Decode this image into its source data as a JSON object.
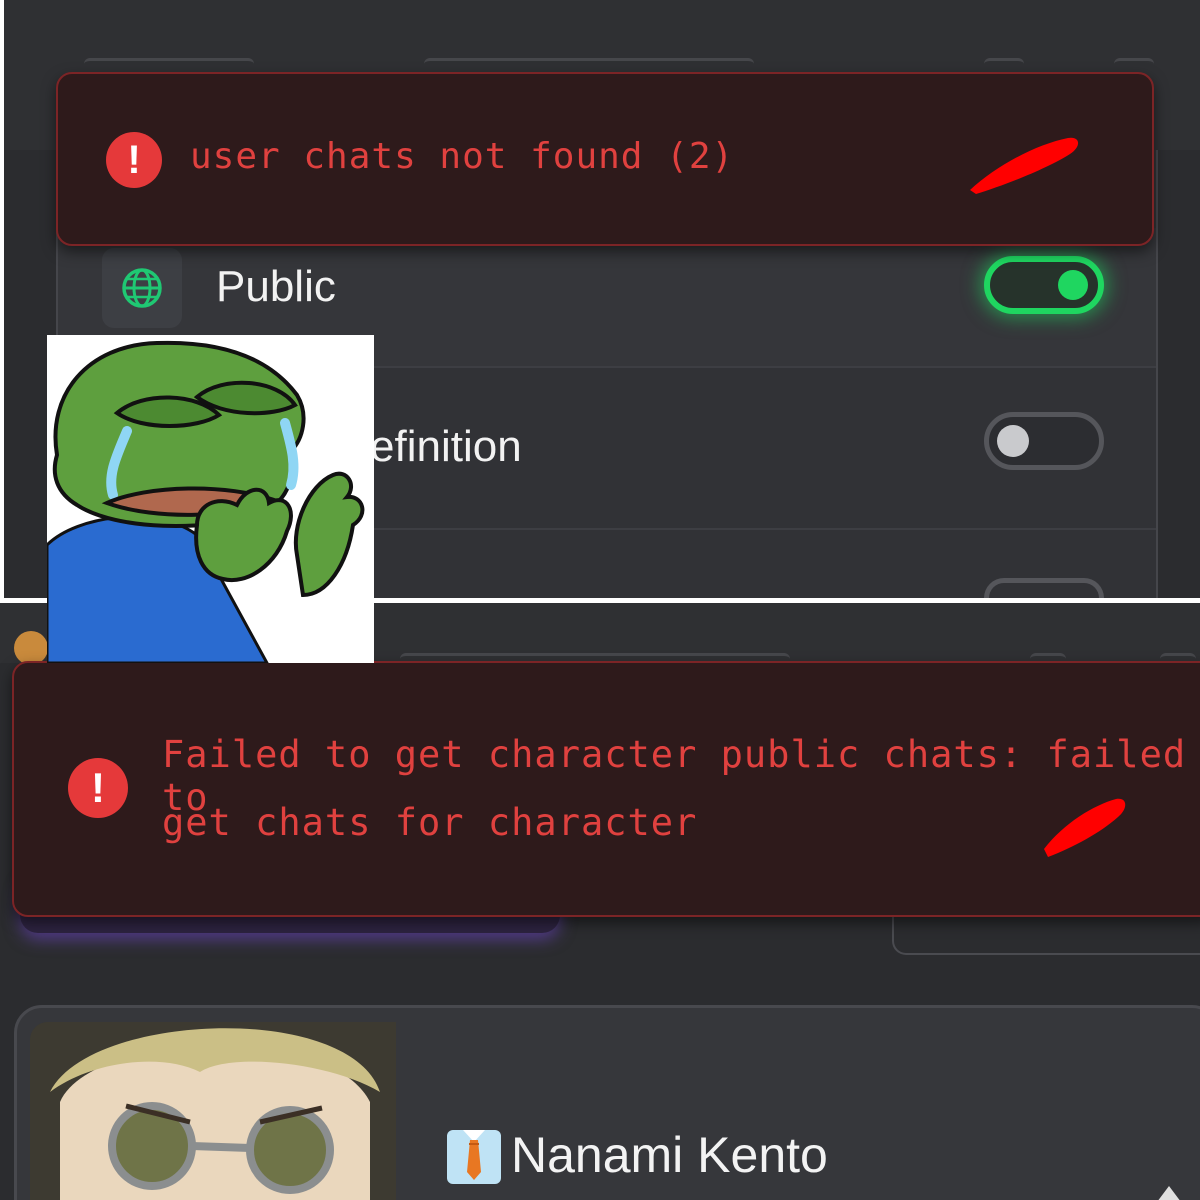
{
  "top_screenshot": {
    "toast": {
      "message": "user chats not found (2)",
      "icon": "exclamation-circle-icon"
    },
    "settings": {
      "public": {
        "label": "Public",
        "icon": "globe-icon",
        "enabled": true
      },
      "definition": {
        "label_visible": "efinition",
        "enabled": false
      }
    }
  },
  "sticker": {
    "description": "crying-frog-sticker"
  },
  "bottom_screenshot": {
    "toast": {
      "line1": "Failed to get character public chats: failed to",
      "line2": "get chats for character",
      "icon": "exclamation-circle-icon"
    },
    "character": {
      "name": "Nanami Kento",
      "icon": "necktie-icon"
    }
  },
  "colors": {
    "toast_text": "#e0413f",
    "toggle_on": "#1fd660",
    "background": "#2b2c2f"
  }
}
